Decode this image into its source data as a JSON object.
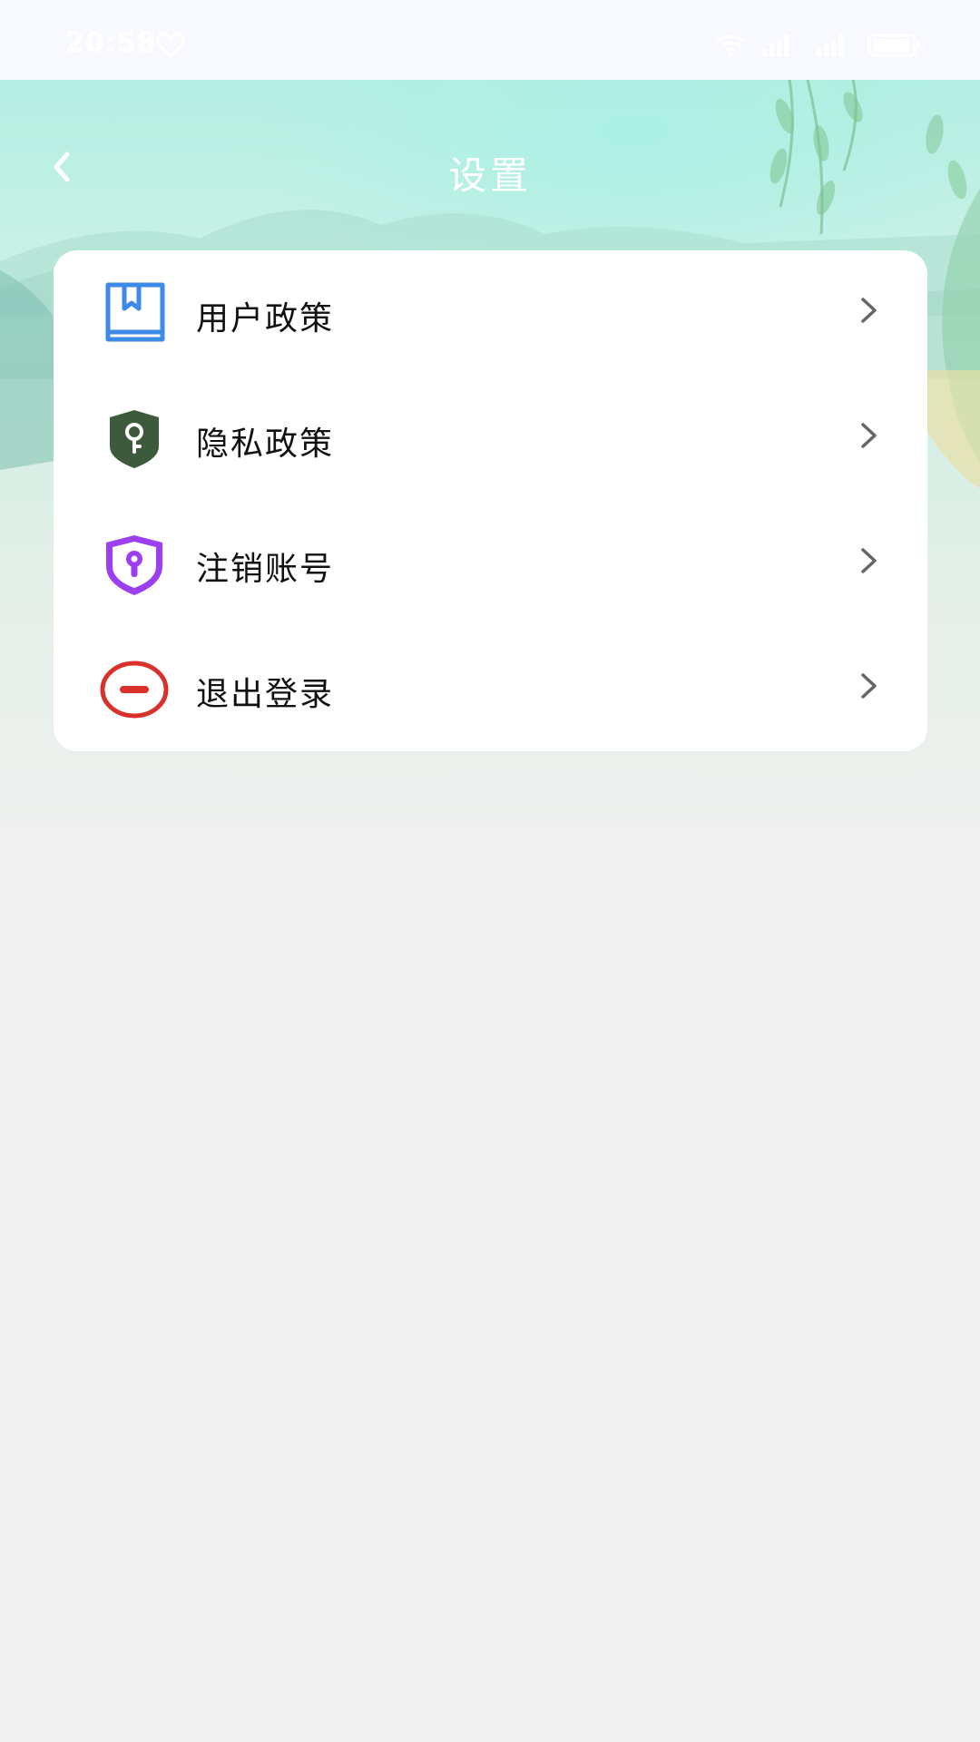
{
  "status_bar": {
    "time": "20:58"
  },
  "header": {
    "title": "设置"
  },
  "menu": {
    "items": [
      {
        "label": "用户政策",
        "icon": "bookmark-book-icon",
        "color": "#3d8be6"
      },
      {
        "label": "隐私政策",
        "icon": "shield-key-icon",
        "color": "#3e5a3d"
      },
      {
        "label": "注销账号",
        "icon": "shield-lock-icon",
        "color": "#9b3ff0"
      },
      {
        "label": "退出登录",
        "icon": "logout-minus-icon",
        "color": "#d9312b"
      }
    ]
  }
}
